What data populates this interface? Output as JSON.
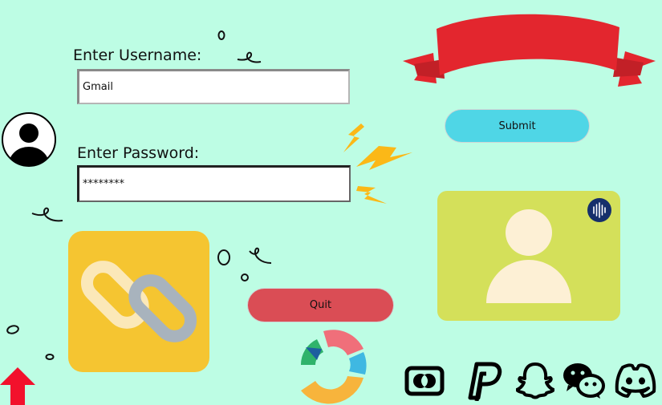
{
  "form": {
    "username_label": "Enter Username:",
    "username_value": "Gmail",
    "password_label": "Enter Password:",
    "password_value": "********"
  },
  "buttons": {
    "submit_label": "Submit",
    "quit_label": "Quit"
  },
  "icons": {
    "avatar": "user-avatar-icon",
    "ribbon": "ribbon-banner-icon",
    "lightning": "lightning-bolts-icon",
    "link": "chain-link-icon",
    "profile_card": "profile-card-icon",
    "voice": "voice-wave-icon",
    "loader": "circular-loader-icon",
    "arrow": "up-arrow-icon",
    "social": [
      "mastercard-icon",
      "paypal-icon",
      "snapchat-icon",
      "wechat-icon",
      "discord-icon"
    ]
  },
  "colors": {
    "background": "#bdfde4",
    "submit": "#4fd6e6",
    "quit": "#da4d55",
    "link_tile": "#f5c531",
    "profile_card": "#d4e05a",
    "ribbon": "#e3262e",
    "lightning": "#fbb817"
  }
}
